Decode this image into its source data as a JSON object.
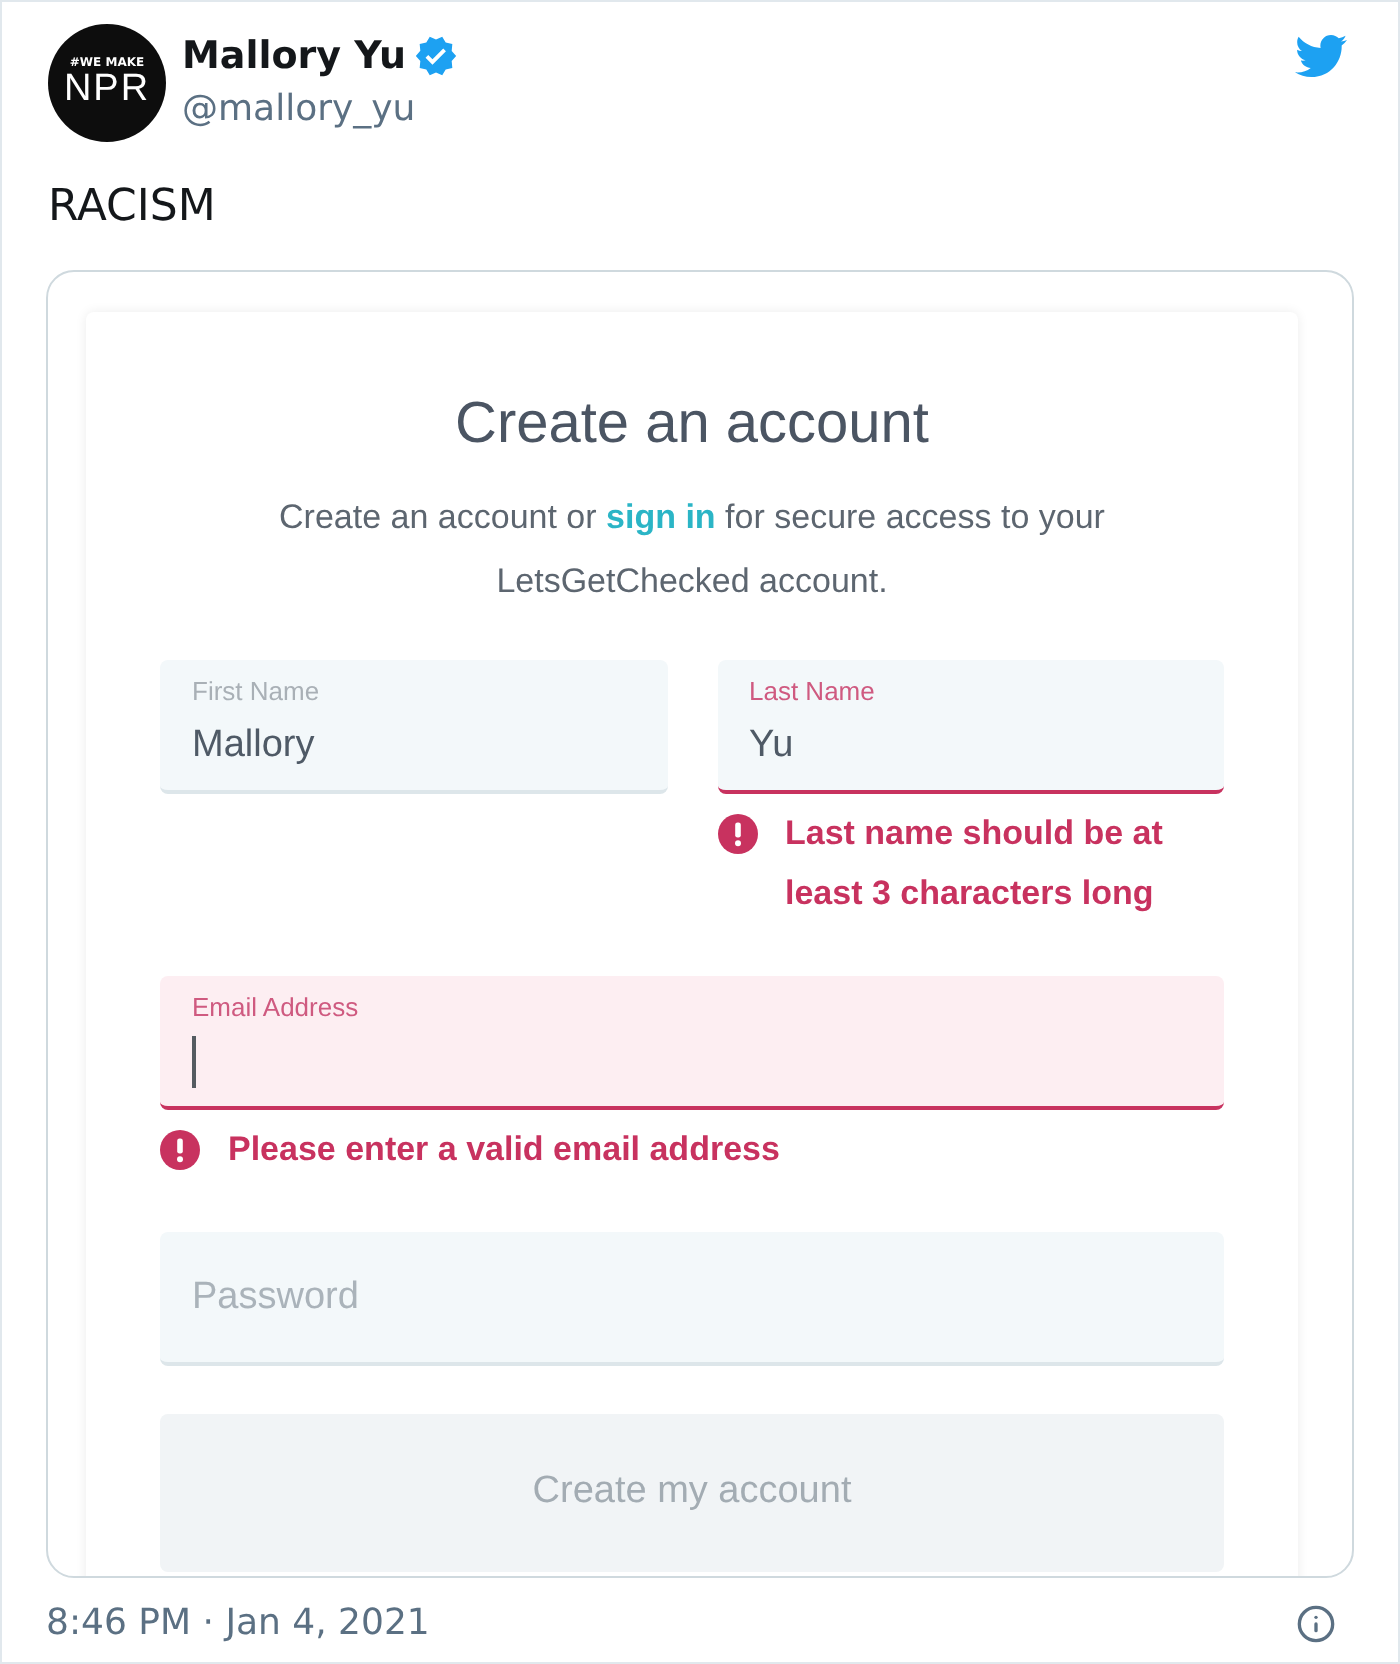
{
  "tweet": {
    "author": {
      "avatar": {
        "line_1": "#WE MAKE",
        "line_2": "NPR"
      },
      "name": "Mallory Yu",
      "verified": true,
      "handle": "@mallory_yu"
    },
    "text": "RACISM"
  },
  "form": {
    "title": "Create an account",
    "intro": {
      "before": "Create an account or",
      "link": "sign in",
      "after": "for secure access to your LetsGetChecked account."
    },
    "rows": [
      {
        "fields": [
          {
            "label": "First Name",
            "value": "Mallory",
            "invalid": false,
            "focused": false
          },
          {
            "label": "Last Name",
            "value": "Yu",
            "invalid": true,
            "focused": false,
            "error": "Last name should be at least 3 characters long"
          }
        ]
      },
      {
        "fields": [
          {
            "label": "Email Address",
            "invalid": true,
            "focused": true,
            "error": "Please enter a valid email address"
          }
        ]
      },
      {
        "fields": [
          {
            "placeholder": "Password",
            "invalid": false,
            "focused": false
          }
        ]
      }
    ],
    "button": {
      "label": "Create my account",
      "disabled": true
    }
  },
  "footer": {
    "timestamp": "8:46 PM · Jan 4, 2021"
  }
}
